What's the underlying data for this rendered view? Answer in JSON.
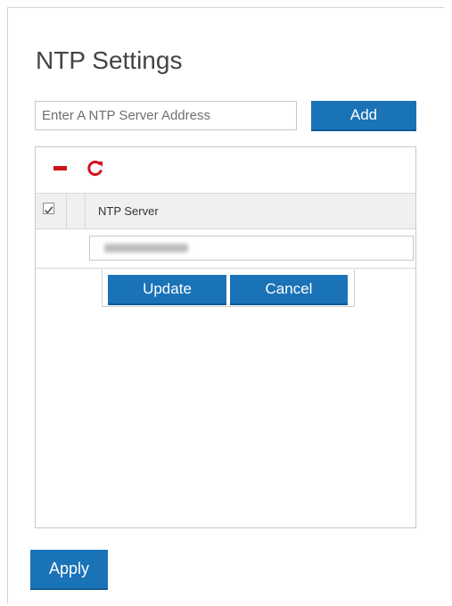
{
  "page": {
    "title": "NTP Settings"
  },
  "ntp_form": {
    "placeholder": "Enter A NTP Server Address",
    "value": "",
    "add_label": "Add"
  },
  "grid": {
    "toolbar": {
      "icons": [
        "minus-icon",
        "refresh-icon"
      ],
      "icon_color": "#d0121b"
    },
    "columns": [
      {
        "label": "NTP Server"
      }
    ],
    "editing_row": {
      "value": ""
    },
    "actions": {
      "update_label": "Update",
      "cancel_label": "Cancel"
    }
  },
  "footer": {
    "apply_label": "Apply"
  },
  "colors": {
    "accent": "#1a72b7",
    "danger": "#d0121b"
  }
}
